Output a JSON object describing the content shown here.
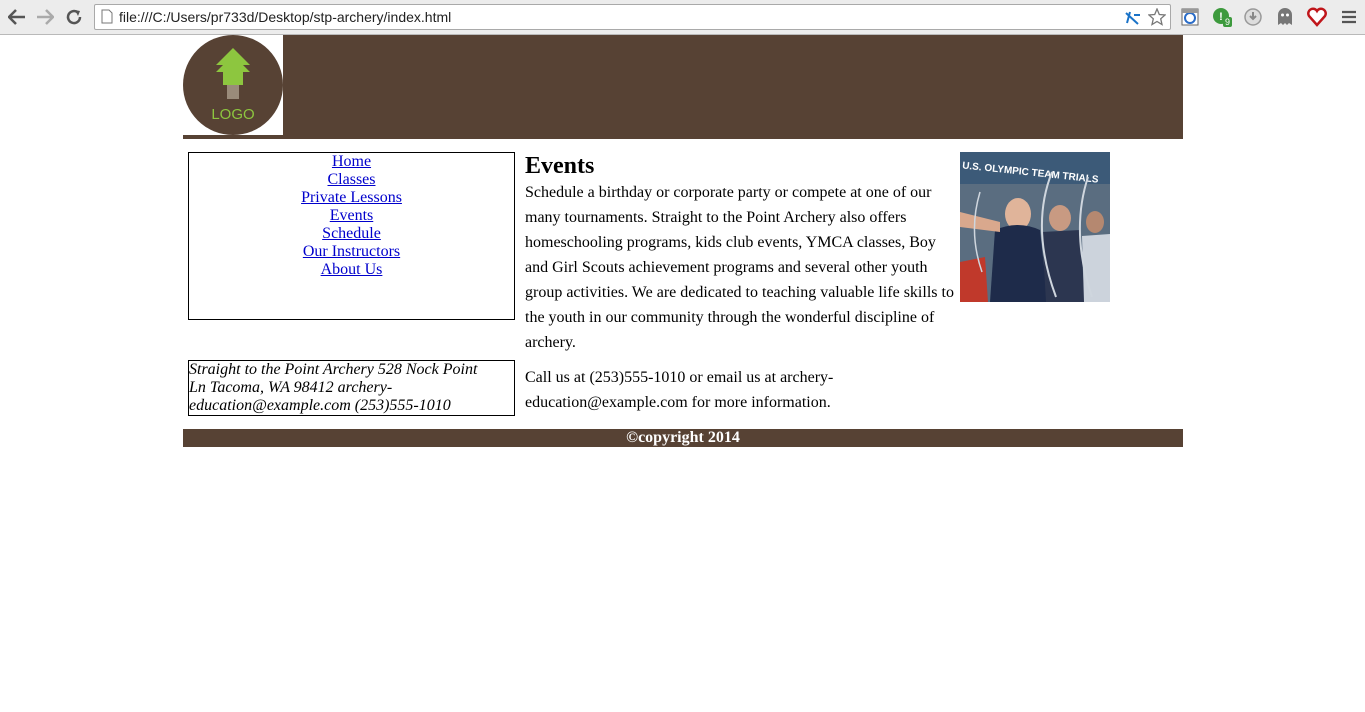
{
  "browser": {
    "url": "file:///C:/Users/pr733d/Desktop/stp-archery/index.html",
    "icons": [
      "back-arrow-icon",
      "forward-arrow-icon",
      "reload-icon",
      "page-icon",
      "translate-icon",
      "bookmark-star-icon",
      "ie-tab-icon",
      "evernote-icon",
      "grey-extension-icon",
      "ghostery-icon",
      "heart-extension-icon",
      "menu-icon"
    ],
    "badge_count": "9"
  },
  "header": {
    "logo_text": "LOGO"
  },
  "nav": {
    "items": [
      {
        "label": "Home"
      },
      {
        "label": "Classes"
      },
      {
        "label": "Private Lessons"
      },
      {
        "label": "Events"
      },
      {
        "label": "Schedule"
      },
      {
        "label": "Our Instructors"
      },
      {
        "label": "About Us"
      }
    ]
  },
  "contact": {
    "text": "Straight to the Point Archery 528 Nock Point Ln Tacoma, WA 98412 archery-education@example.com (253)555-1010"
  },
  "main": {
    "title": "Events",
    "paragraph1": "Schedule a birthday or corporate party or compete at one of our many tournaments. Straight to the Point Archery also offers homeschooling programs, kids club events, YMCA classes, Boy and Girl Scouts achievement programs and several other youth group activities. We are dedicated to teaching valuable life skills to the youth in our community through the wonderful discipline of archery.",
    "paragraph2": "Call us at (253)555-1010 or email us at archery-education@example.com for more information."
  },
  "photo": {
    "banner_text": "U.S. OLYMPIC TEAM TRIALS"
  },
  "footer": {
    "text": "©copyright 2014"
  },
  "colors": {
    "brand_brown": "#574234",
    "logo_green": "#8dc63f",
    "link_blue": "#0000cc"
  }
}
